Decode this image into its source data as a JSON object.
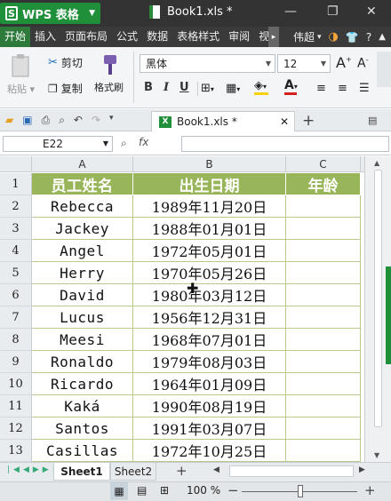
{
  "app": {
    "name": "WPS 表格",
    "title": "Book1.xls *",
    "logo_letter": "S"
  },
  "menubar": {
    "items": [
      "开始",
      "插入",
      "页面布局",
      "公式",
      "数据",
      "表格样式",
      "审阅",
      "视"
    ],
    "active": "开始",
    "user": "伟超"
  },
  "ribbon": {
    "paste_label": "粘贴",
    "cut_label": "剪切",
    "copy_label": "复制",
    "format_painter_label": "格式刷",
    "font_name": "黑体",
    "font_size": "12",
    "bold": "B",
    "italic": "I",
    "underline": "U",
    "grow_font": "A",
    "shrink_font": "A"
  },
  "doc_tab": {
    "label": "Book1.xls *",
    "excel_badge": "X"
  },
  "formula_bar": {
    "cell_ref": "E22",
    "fx_label": "fx",
    "value": ""
  },
  "columns": [
    "A",
    "B",
    "C"
  ],
  "rows": [
    {
      "num": "1",
      "name": "员工姓名",
      "date": "出生日期",
      "age": "年龄"
    },
    {
      "num": "2",
      "name": "Rebecca",
      "date": "1989年11月20日",
      "age": ""
    },
    {
      "num": "3",
      "name": "Jackey",
      "date": "1988年01月01日",
      "age": ""
    },
    {
      "num": "4",
      "name": "Angel",
      "date": "1972年05月01日",
      "age": ""
    },
    {
      "num": "5",
      "name": "Herry",
      "date": "1970年05月26日",
      "age": ""
    },
    {
      "num": "6",
      "name": "David",
      "date": "1980年03月12日",
      "age": ""
    },
    {
      "num": "7",
      "name": "Lucus",
      "date": "1956年12月31日",
      "age": ""
    },
    {
      "num": "8",
      "name": "Meesi",
      "date": "1968年07月01日",
      "age": ""
    },
    {
      "num": "9",
      "name": "Ronaldo",
      "date": "1979年08月03日",
      "age": ""
    },
    {
      "num": "10",
      "name": "Ricardo",
      "date": "1964年01月09日",
      "age": ""
    },
    {
      "num": "11",
      "name": "Kaká",
      "date": "1990年08月19日",
      "age": ""
    },
    {
      "num": "12",
      "name": "Santos",
      "date": "1991年03月07日",
      "age": ""
    },
    {
      "num": "13",
      "name": "Casillas",
      "date": "1972年10月25日",
      "age": ""
    }
  ],
  "sheets": {
    "tabs": [
      "Sheet1",
      "Sheet2"
    ],
    "active": "Sheet1",
    "add": "+"
  },
  "status": {
    "zoom": "100 %"
  },
  "colors": {
    "header_fill": "#99b55a",
    "border": "#b8c98e",
    "accent": "#1f8f3a"
  }
}
